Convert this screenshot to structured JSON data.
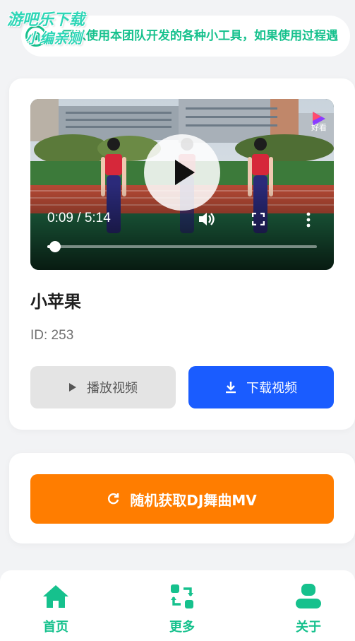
{
  "notice": {
    "text": "可以使用本团队开发的各种小工具，如果使用过程遇",
    "icon": "speaker-icon"
  },
  "watermark": {
    "line1": "游吧乐下载",
    "line2": "小编亲测"
  },
  "player": {
    "current_time": "0:09",
    "duration": "5:14",
    "progress": 0.03,
    "brand_label": "好看",
    "time_separator": " / "
  },
  "song": {
    "title": "小苹果",
    "id_text": "ID: 253"
  },
  "actions": {
    "play_label": "播放视频",
    "download_label": "下载视频",
    "random_label": "随机获取DJ舞曲MV"
  },
  "nav": {
    "items": [
      {
        "label": "首页",
        "icon": "home-icon"
      },
      {
        "label": "更多",
        "icon": "refresh-grid-icon"
      },
      {
        "label": "关于",
        "icon": "user-icon"
      }
    ]
  },
  "colors": {
    "accent_green": "#16c18d",
    "download_blue": "#1a5cff",
    "random_orange": "#ff7d00"
  }
}
